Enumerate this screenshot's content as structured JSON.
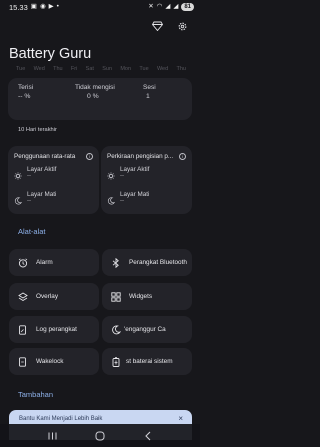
{
  "status_bar": {
    "time": "15.33",
    "battery": "81"
  },
  "app": {
    "title": "Battery Guru"
  },
  "chart_ticks": [
    "Tue",
    "Wed",
    "Thu",
    "Fri",
    "Sat",
    "Sun",
    "Mon",
    "Tue",
    "Wed",
    "Thu"
  ],
  "summary": {
    "charged_label": "Terisi",
    "charged_value": "-- %",
    "not_charging_label": "Tidak mengisi",
    "not_charging_value": "0 %",
    "session_label": "Sesi",
    "session_value": "1"
  },
  "period_label": "10 Hari terakhir",
  "usage_avg": {
    "title": "Penggunaan rata-rata",
    "screen_on_label": "Layar Aktif",
    "screen_on_value": "--",
    "screen_off_label": "Layar Mati",
    "screen_off_value": "--"
  },
  "charge_estimate": {
    "title": "Perkiraan pengisian p...",
    "screen_on_label": "Layar Aktif",
    "screen_on_value": "--",
    "screen_off_label": "Layar Mati",
    "screen_off_value": "--"
  },
  "tools_section": {
    "title": "Alat-alat",
    "items": [
      {
        "label": "Alarm",
        "icon": "alarm-icon"
      },
      {
        "label": "Perangkat Bluetooth",
        "icon": "bluetooth-icon"
      },
      {
        "label": "Overlay",
        "icon": "layers-icon"
      },
      {
        "label": "Widgets",
        "icon": "widgets-icon"
      },
      {
        "label": "Log perangkat",
        "icon": "log-icon"
      },
      {
        "label": "'enganggur Ca",
        "icon": "idle-moon-icon"
      },
      {
        "label": "Wakelock",
        "icon": "wakelock-icon"
      },
      {
        "label": "st baterai sistem",
        "icon": "battery-stats-icon"
      }
    ]
  },
  "extra_section": {
    "title": "Tambahan"
  },
  "banner": {
    "text": "Bantu Kami Menjadi Lebih Baik",
    "close_symbol": "×"
  }
}
